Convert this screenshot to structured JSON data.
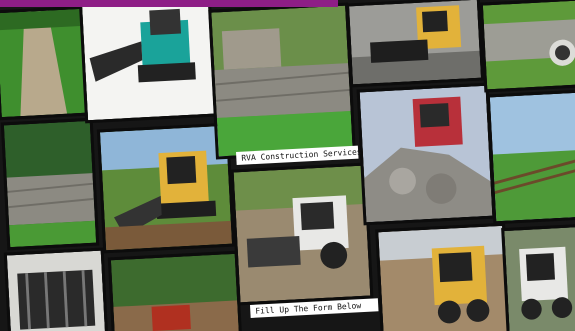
{
  "captions": {
    "company": "RVA Construction Services",
    "cta": "Fill Up The Form Below"
  },
  "colors": {
    "accent_bar": "#8e1e86",
    "grass": "#3f8f2e",
    "stone": "#8c8a82",
    "machine_yellow": "#e2b23a",
    "machine_teal": "#1aa39a",
    "machine_white": "#e8e8e6",
    "dirt": "#8a6a4a"
  }
}
